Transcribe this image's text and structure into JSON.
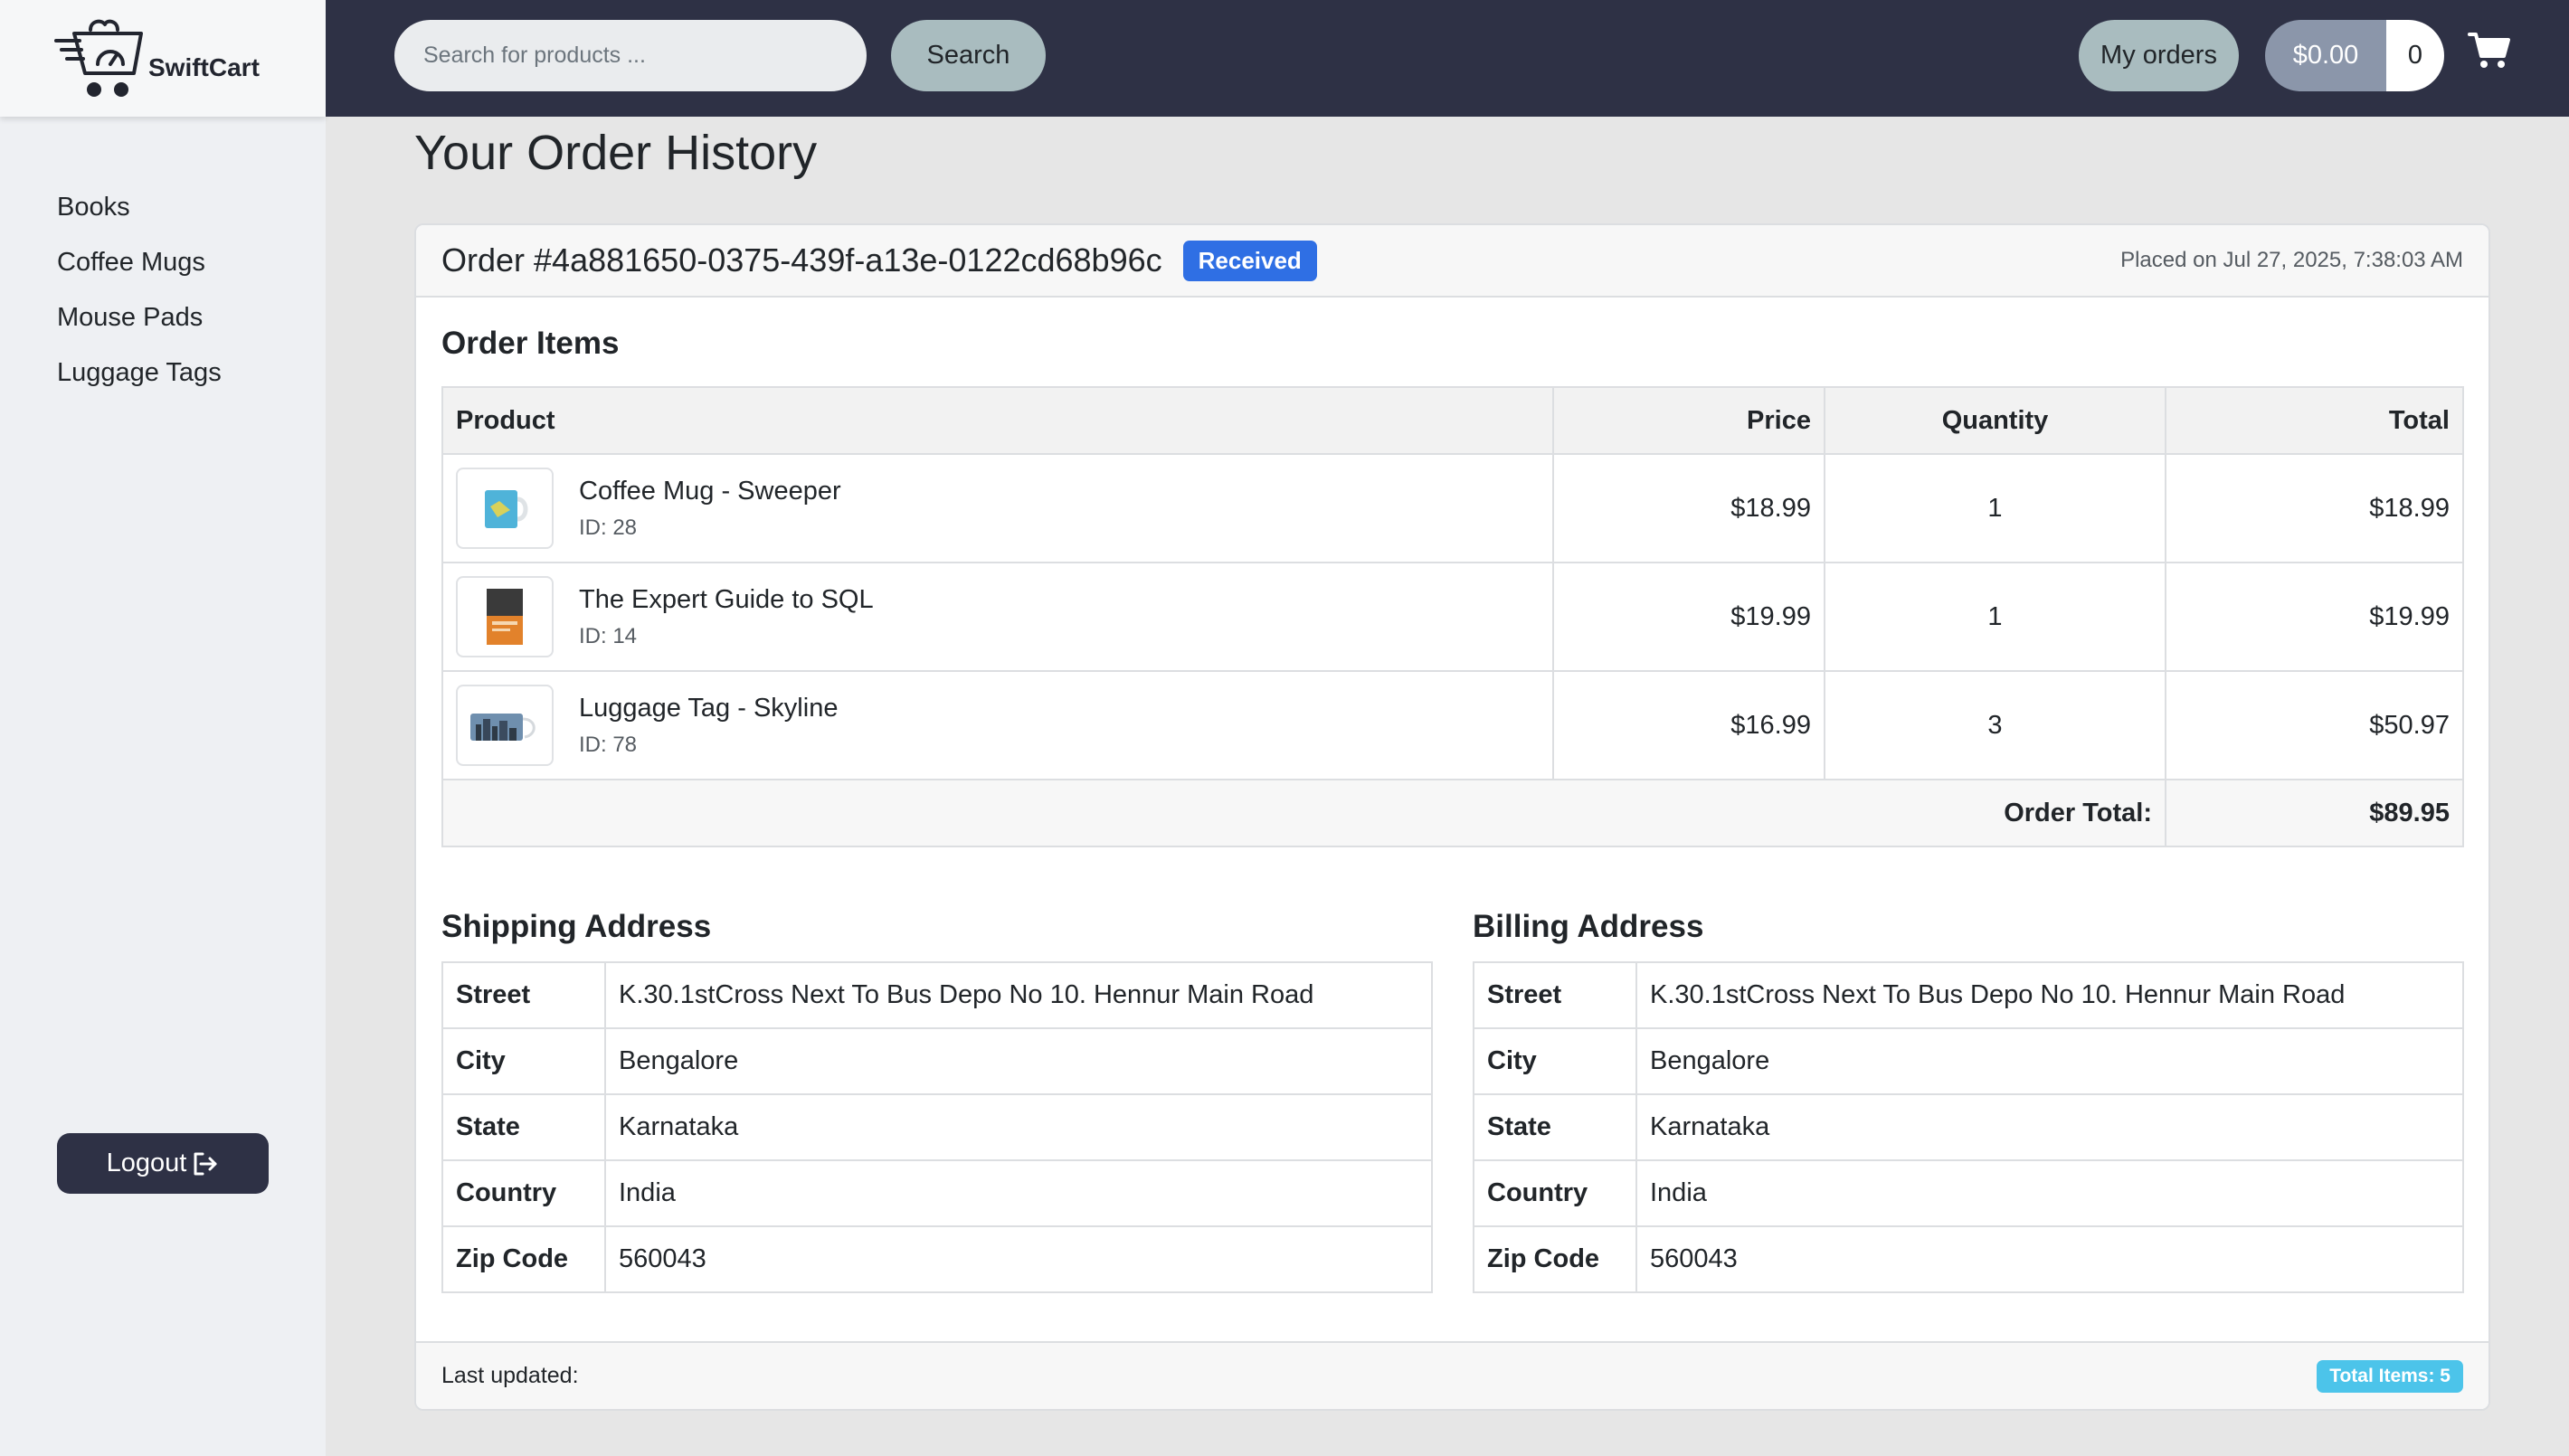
{
  "brand": {
    "name": "SwiftCart"
  },
  "sidebar": {
    "items": [
      {
        "label": "Books"
      },
      {
        "label": "Coffee Mugs"
      },
      {
        "label": "Mouse Pads"
      },
      {
        "label": "Luggage Tags"
      }
    ],
    "logout_label": "Logout"
  },
  "topbar": {
    "search_placeholder": "Search for products ...",
    "search_label": "Search",
    "orders_label": "My orders",
    "cart_amount": "$0.00",
    "cart_count": "0"
  },
  "page": {
    "title": "Your Order History"
  },
  "order": {
    "number": "Order #4a881650-0375-439f-a13e-0122cd68b96c",
    "status": "Received",
    "placed_on": "Placed on Jul 27, 2025, 7:38:03 AM",
    "items_title": "Order Items",
    "columns": {
      "product": "Product",
      "price": "Price",
      "quantity": "Quantity",
      "total": "Total"
    },
    "items": [
      {
        "name": "Coffee Mug - Sweeper",
        "id": "ID: 28",
        "price": "$18.99",
        "quantity": "1",
        "total": "$18.99"
      },
      {
        "name": "The Expert Guide to SQL",
        "id": "ID: 14",
        "price": "$19.99",
        "quantity": "1",
        "total": "$19.99"
      },
      {
        "name": "Luggage Tag - Skyline",
        "id": "ID: 78",
        "price": "$16.99",
        "quantity": "3",
        "total": "$50.97"
      }
    ],
    "order_total_label": "Order Total:",
    "order_total": "$89.95",
    "shipping": {
      "title": "Shipping Address",
      "rows": [
        {
          "key": "Street",
          "value": "K.30.1stCross Next To Bus Depo No 10. Hennur Main Road"
        },
        {
          "key": "City",
          "value": "Bengalore"
        },
        {
          "key": "State",
          "value": "Karnataka"
        },
        {
          "key": "Country",
          "value": "India"
        },
        {
          "key": "Zip Code",
          "value": "560043"
        }
      ]
    },
    "billing": {
      "title": "Billing Address",
      "rows": [
        {
          "key": "Street",
          "value": "K.30.1stCross Next To Bus Depo No 10. Hennur Main Road"
        },
        {
          "key": "City",
          "value": "Bengalore"
        },
        {
          "key": "State",
          "value": "Karnataka"
        },
        {
          "key": "Country",
          "value": "India"
        },
        {
          "key": "Zip Code",
          "value": "560043"
        }
      ]
    },
    "last_updated": "Last updated:",
    "total_items": "Total Items: 5"
  },
  "icons": {
    "logo": "shopping-cart-logo-icon",
    "cart": "shopping-cart-icon",
    "logout": "sign-out-icon",
    "thumbs": [
      "coffee-mug-thumbnail",
      "book-thumbnail",
      "luggage-tag-thumbnail"
    ]
  },
  "colors": {
    "topbar": "#2e3145",
    "status_badge": "#2f6fe4",
    "items_badge": "#4cc4ea",
    "pill_button": "#a9bcbf"
  }
}
